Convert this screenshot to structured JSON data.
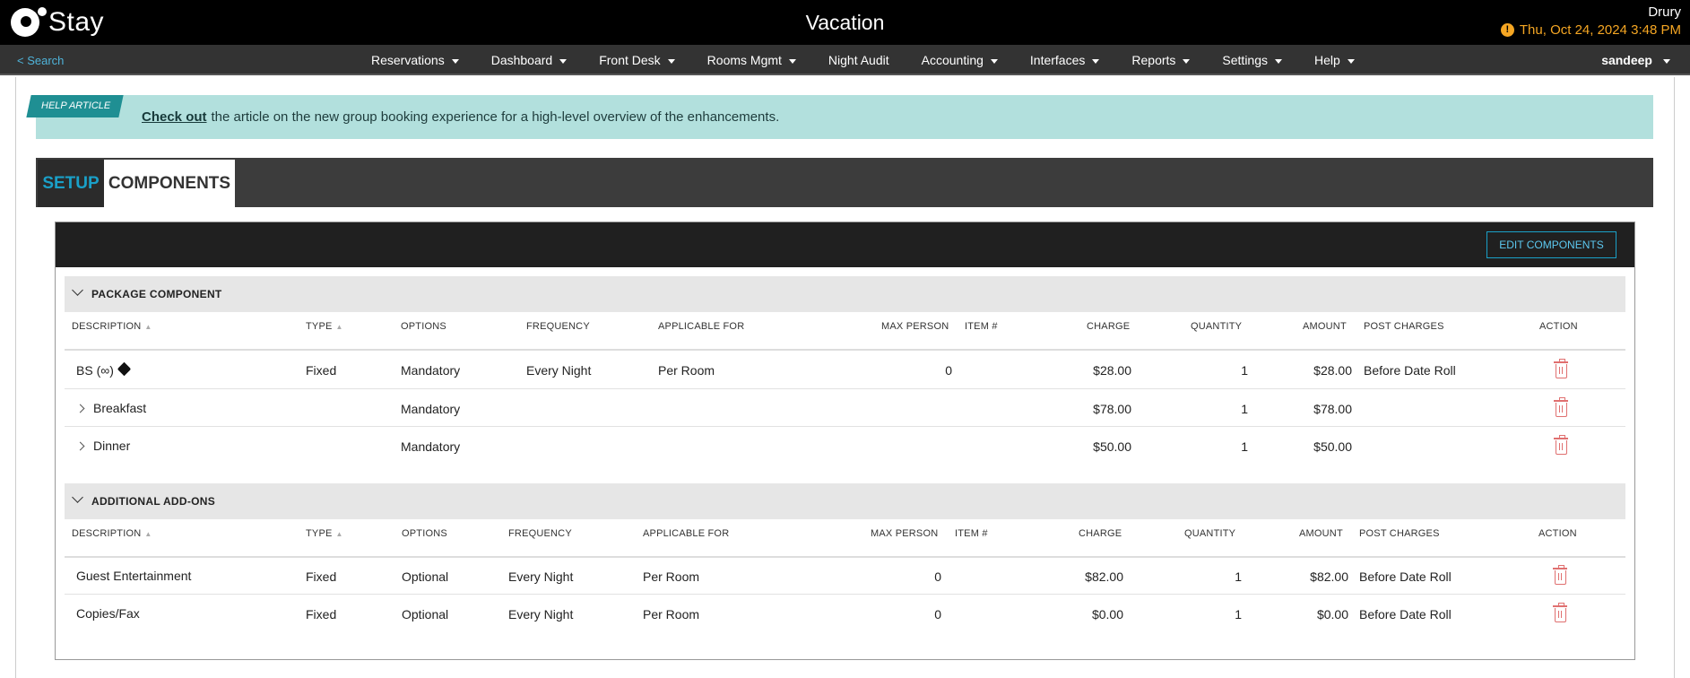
{
  "header": {
    "logo_text": "Stay",
    "hotel_title": "Vacation",
    "user_name": "Drury",
    "datetime": "Thu, Oct 24, 2024 3:48 PM"
  },
  "nav": {
    "search_label": "< Search",
    "items": [
      {
        "label": "Reservations",
        "dropdown": true
      },
      {
        "label": "Dashboard",
        "dropdown": true
      },
      {
        "label": "Front Desk",
        "dropdown": true
      },
      {
        "label": "Rooms Mgmt",
        "dropdown": true
      },
      {
        "label": "Night Audit",
        "dropdown": false
      },
      {
        "label": "Accounting",
        "dropdown": true
      },
      {
        "label": "Interfaces",
        "dropdown": true
      },
      {
        "label": "Reports",
        "dropdown": true
      },
      {
        "label": "Settings",
        "dropdown": true
      },
      {
        "label": "Help",
        "dropdown": true
      }
    ],
    "username": "sandeep"
  },
  "help": {
    "tag": "HELP ARTICLE",
    "link_text": "Check out",
    "text": "the article on the new group booking experience for a high-level overview of the enhancements."
  },
  "tabs": {
    "setup": "SETUP",
    "components": "COMPONENTS"
  },
  "edit_button": "EDIT COMPONENTS",
  "columns": {
    "description": "DESCRIPTION",
    "type": "TYPE",
    "options": "OPTIONS",
    "frequency": "FREQUENCY",
    "applicable_for": "APPLICABLE FOR",
    "max_person": "MAX PERSON",
    "item_no": "ITEM #",
    "charge": "CHARGE",
    "quantity": "QUANTITY",
    "amount": "AMOUNT",
    "post_charges": "POST CHARGES",
    "action": "ACTION"
  },
  "package_section": {
    "title": "PACKAGE COMPONENT",
    "rows": [
      {
        "description": "BS (∞)",
        "type": "Fixed",
        "options": "Mandatory",
        "frequency": "Every Night",
        "applicable_for": "Per Room",
        "max_person": "0",
        "item_no": "",
        "charge": "$28.00",
        "quantity": "1",
        "amount": "$28.00",
        "post_charges": "Before Date Roll"
      },
      {
        "description": "Breakfast",
        "type": "",
        "options": "Mandatory",
        "frequency": "",
        "applicable_for": "",
        "max_person": "",
        "item_no": "",
        "charge": "$78.00",
        "quantity": "1",
        "amount": "$78.00",
        "post_charges": ""
      },
      {
        "description": "Dinner",
        "type": "",
        "options": "Mandatory",
        "frequency": "",
        "applicable_for": "",
        "max_person": "",
        "item_no": "",
        "charge": "$50.00",
        "quantity": "1",
        "amount": "$50.00",
        "post_charges": ""
      }
    ]
  },
  "addons_section": {
    "title": "ADDITIONAL ADD-ONS",
    "rows": [
      {
        "description": "Guest Entertainment",
        "type": "Fixed",
        "options": "Optional",
        "frequency": "Every Night",
        "applicable_for": "Per Room",
        "max_person": "0",
        "item_no": "",
        "charge": "$82.00",
        "quantity": "1",
        "amount": "$82.00",
        "post_charges": "Before Date Roll"
      },
      {
        "description": "Copies/Fax",
        "type": "Fixed",
        "options": "Optional",
        "frequency": "Every Night",
        "applicable_for": "Per Room",
        "max_person": "0",
        "item_no": "",
        "charge": "$0.00",
        "quantity": "1",
        "amount": "$0.00",
        "post_charges": "Before Date Roll"
      }
    ]
  },
  "colors": {
    "accent": "#1aa0c8",
    "warning": "#f5a623",
    "help_bg": "#b2e0dd",
    "delete": "#e07070"
  }
}
